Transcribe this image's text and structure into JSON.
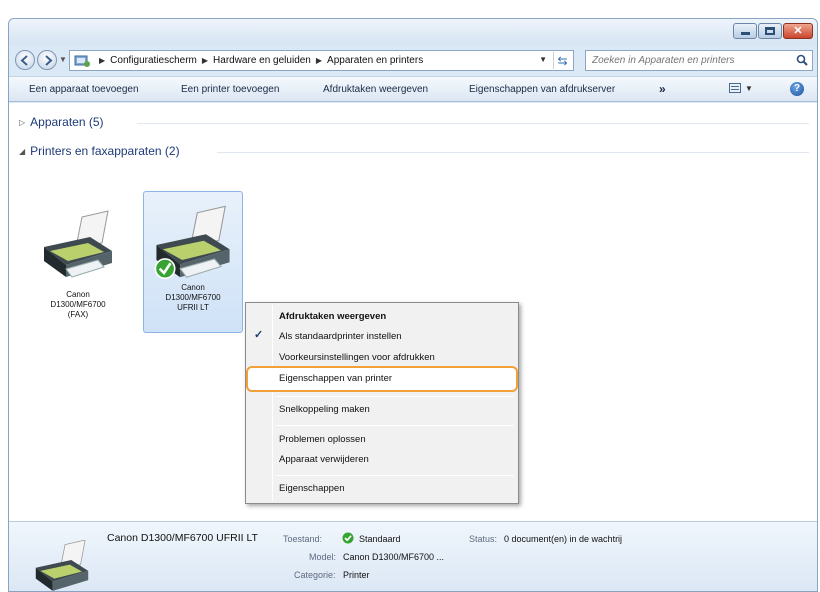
{
  "address_bar": {
    "crumbs": [
      "Configuratiescherm",
      "Hardware en geluiden",
      "Apparaten en printers"
    ],
    "search_placeholder": "Zoeken in Apparaten en printers"
  },
  "command_bar": {
    "items": [
      "Een apparaat toevoegen",
      "Een printer toevoegen",
      "Afdruktaken weergeven",
      "Eigenschappen van afdrukserver"
    ],
    "more": "»"
  },
  "groups": {
    "devices": "Apparaten (5)",
    "printers": "Printers en faxapparaten (2)"
  },
  "printers": [
    {
      "label": "Canon\nD1300/MF6700\n(FAX)"
    },
    {
      "label": "Canon\nD1300/MF6700\nUFRII LT",
      "default": true
    }
  ],
  "context_menu": {
    "items": [
      "Afdruktaken weergeven",
      "Als standaardprinter instellen",
      "Voorkeursinstellingen voor afdrukken",
      "Eigenschappen van printer",
      "Snelkoppeling maken",
      "Problemen oplossen",
      "Apparaat verwijderen",
      "Eigenschappen"
    ],
    "highlight_color": "#f2a03a"
  },
  "details": {
    "name": "Canon D1300/MF6700 UFRII LT",
    "state_key": "Toestand:",
    "state_val": "Standaard",
    "status_key": "Status:",
    "status_val": "0 document(en) in de wachtrij",
    "model_key": "Model:",
    "model_val": "Canon D1300/MF6700 ...",
    "category_key": "Categorie:",
    "category_val": "Printer"
  }
}
